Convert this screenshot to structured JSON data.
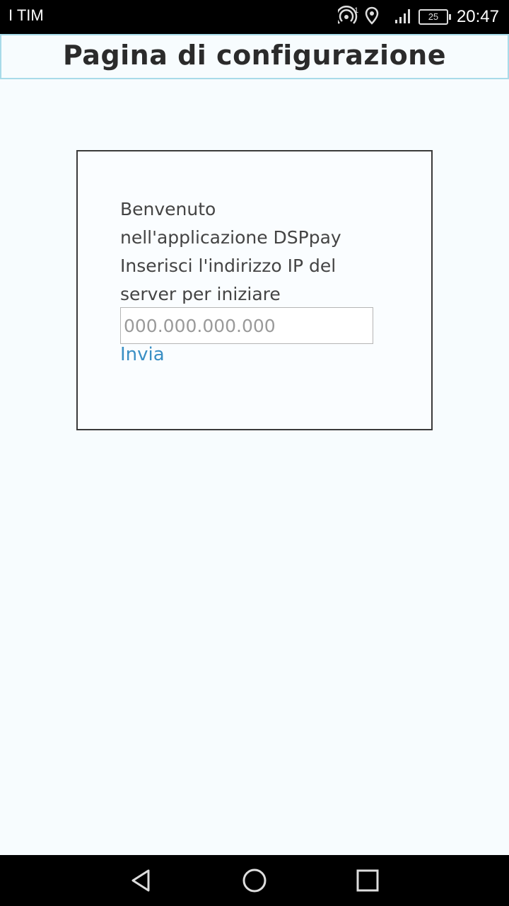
{
  "status_bar": {
    "carrier": "I TIM",
    "hotspot_badge": "1",
    "battery_level": "25",
    "time": "20:47",
    "icons": [
      "hotspot-icon",
      "location-icon",
      "signal-icon",
      "battery-icon"
    ]
  },
  "header": {
    "title": "Pagina di configurazione"
  },
  "card": {
    "welcome_lines": [
      "Benvenuto",
      "nell'applicazione DSPpay",
      "Inserisci l'indirizzo IP del",
      "server per iniziare"
    ],
    "ip_input": {
      "value": "",
      "placeholder": "000.000.000.000"
    },
    "submit_label": "Invia"
  },
  "nav_bar": {
    "icons": [
      "back-icon",
      "home-icon",
      "recents-icon"
    ]
  },
  "colors": {
    "background": "#f7fcfe",
    "header_border": "#a8dbe9",
    "link": "#3a8fc4",
    "text": "#444444"
  }
}
